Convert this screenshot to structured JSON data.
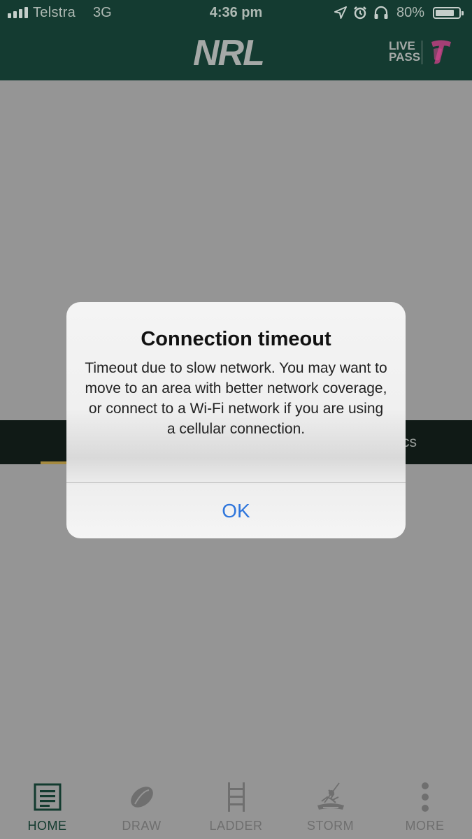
{
  "status": {
    "carrier": "Telstra",
    "network": "3G",
    "time": "4:36 pm",
    "battery_percent": "80%",
    "battery_level": 0.8,
    "icons": [
      "signal-icon",
      "location-icon",
      "alarm-icon",
      "headphones-icon",
      "battery-icon"
    ]
  },
  "header": {
    "logo": "NRL",
    "live_pass_line1": "LIVE",
    "live_pass_line2": "PASS",
    "sponsor_logo": "T"
  },
  "tab_strip": {
    "partial_label": "cs"
  },
  "alert": {
    "title": "Connection timeout",
    "message": "Timeout due to slow network. You may want to move to an area with better network coverage, or connect to a Wi-Fi network if you are using a cellular connection.",
    "ok_label": "OK"
  },
  "tabbar": {
    "items": [
      {
        "label": "HOME",
        "icon": "news-icon",
        "active": true
      },
      {
        "label": "DRAW",
        "icon": "football-icon",
        "active": false
      },
      {
        "label": "LADDER",
        "icon": "ladder-icon",
        "active": false
      },
      {
        "label": "STORM",
        "icon": "storm-logo-icon",
        "active": false
      },
      {
        "label": "MORE",
        "icon": "more-icon",
        "active": false
      }
    ]
  },
  "colors": {
    "header_bg": "#143b31",
    "overlay_bg": "#959595",
    "tab_strip_bg": "#101a16",
    "accent_gold": "#a58a40",
    "ios_blue": "#2f76dc",
    "active_tab": "#133b2f"
  }
}
